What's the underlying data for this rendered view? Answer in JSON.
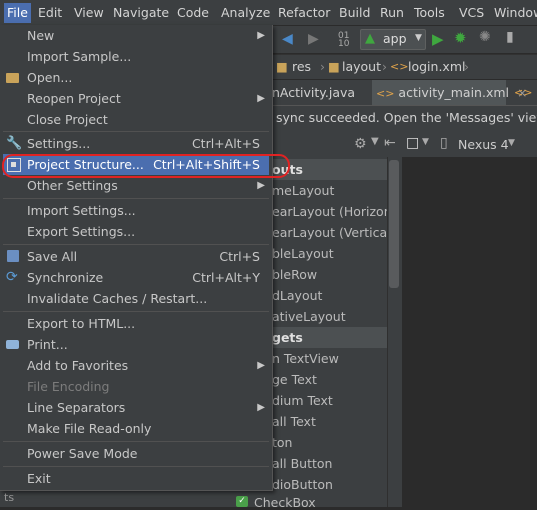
{
  "menubar": {
    "items": [
      "File",
      "Edit",
      "View",
      "Navigate",
      "Code",
      "Analyze",
      "Refactor",
      "Build",
      "Run",
      "Tools",
      "VCS",
      "Window"
    ]
  },
  "toolbar": {
    "run_config": "app",
    "device": "Nexus 4"
  },
  "breadcrumbs": [
    "res",
    "layout",
    "login.xml"
  ],
  "tabs": [
    "nActivity.java",
    "activity_main.xml"
  ],
  "notification": "sync succeeded. Open the 'Messages' view to",
  "palette": {
    "rows": [
      "outs",
      "meLayout",
      "earLayout (Horizonta",
      "earLayout (Vertical)",
      "bleLayout",
      "bleRow",
      "dLayout",
      "ativeLayout",
      "gets",
      "n TextView",
      "ge Text",
      "dium Text",
      "all Text",
      "ton",
      "all Button",
      "dioButton"
    ],
    "checkbox_label": "CheckBox"
  },
  "bottom_strip_text": "ts",
  "file_menu": {
    "items": [
      {
        "label": "New",
        "shortcut": "",
        "submenu": true
      },
      {
        "label": "Import Sample...",
        "shortcut": ""
      },
      {
        "label": "Open...",
        "shortcut": ""
      },
      {
        "label": "Reopen Project",
        "shortcut": "",
        "submenu": true
      },
      {
        "label": "Close Project",
        "shortcut": ""
      },
      {
        "label": "Settings...",
        "shortcut": "Ctrl+Alt+S"
      },
      {
        "label": "Project Structure...",
        "shortcut": "Ctrl+Alt+Shift+S"
      },
      {
        "label": "Other Settings",
        "shortcut": "",
        "submenu": true
      },
      {
        "label": "Import Settings...",
        "shortcut": ""
      },
      {
        "label": "Export Settings...",
        "shortcut": ""
      },
      {
        "label": "Save All",
        "shortcut": "Ctrl+S"
      },
      {
        "label": "Synchronize",
        "shortcut": "Ctrl+Alt+Y"
      },
      {
        "label": "Invalidate Caches / Restart...",
        "shortcut": ""
      },
      {
        "label": "Export to HTML...",
        "shortcut": ""
      },
      {
        "label": "Print...",
        "shortcut": ""
      },
      {
        "label": "Add to Favorites",
        "shortcut": "",
        "submenu": true
      },
      {
        "label": "File Encoding",
        "shortcut": ""
      },
      {
        "label": "Line Separators",
        "shortcut": "",
        "submenu": true
      },
      {
        "label": "Make File Read-only",
        "shortcut": ""
      },
      {
        "label": "Power Save Mode",
        "shortcut": ""
      },
      {
        "label": "Exit",
        "shortcut": ""
      }
    ],
    "highlighted_index": 6,
    "disabled_index": 16
  },
  "colors": {
    "menu_bg": "#3c3f41",
    "selection": "#4b6eaf",
    "annotation": "#e02323",
    "editor_bg": "#2b2b2b"
  }
}
